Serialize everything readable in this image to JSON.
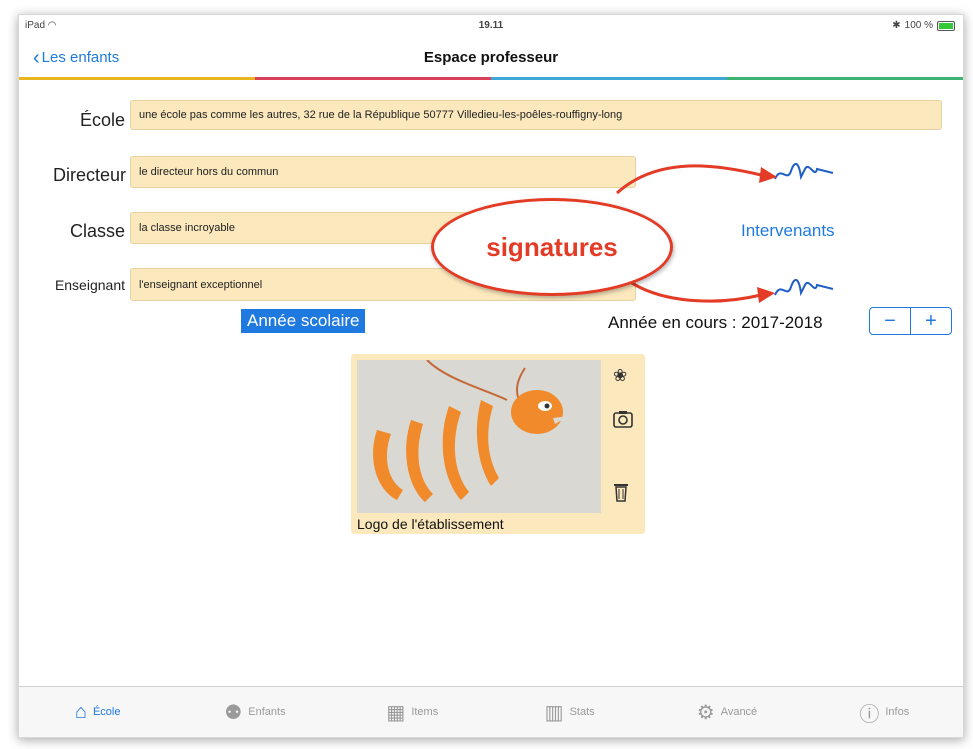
{
  "status": {
    "device": "iPad",
    "time": "19.11",
    "battery": "100 %"
  },
  "nav": {
    "back_label": "Les enfants",
    "title": "Espace professeur"
  },
  "rainbow_colors": [
    "#e8b51f",
    "#d9405a",
    "#3fa7d6",
    "#3cb371"
  ],
  "form": {
    "ecole_label": "École",
    "ecole_value": "une école pas comme les autres, 32 rue de la République 50777 Villedieu-les-poêles-rouffigny-long",
    "directeur_label": "Directeur",
    "directeur_value": "le directeur hors du commun",
    "classe_label": "Classe",
    "classe_value": "la classe incroyable",
    "enseignant_label": "Enseignant",
    "enseignant_value": "l'enseignant exceptionnel"
  },
  "signatures_callout": "signatures",
  "intervenants_label": "Intervenants",
  "annee_button": "Année scolaire",
  "annee_cours": "Année en cours : 2017-2018",
  "stepper": {
    "minus": "−",
    "plus": "+"
  },
  "logo": {
    "caption": "Logo de l'établissement"
  },
  "tabs": [
    {
      "label": "École",
      "icon": "house-icon",
      "active": true
    },
    {
      "label": "Enfants",
      "icon": "people-icon"
    },
    {
      "label": "Items",
      "icon": "grid-icon"
    },
    {
      "label": "Stats",
      "icon": "chart-icon"
    },
    {
      "label": "Avancé",
      "icon": "gear-icon"
    },
    {
      "label": "Infos",
      "icon": "info-icon"
    }
  ],
  "colors": {
    "accent": "#1f7ae0",
    "field_bg": "#fbe8bd",
    "callout": "#e33b26"
  }
}
